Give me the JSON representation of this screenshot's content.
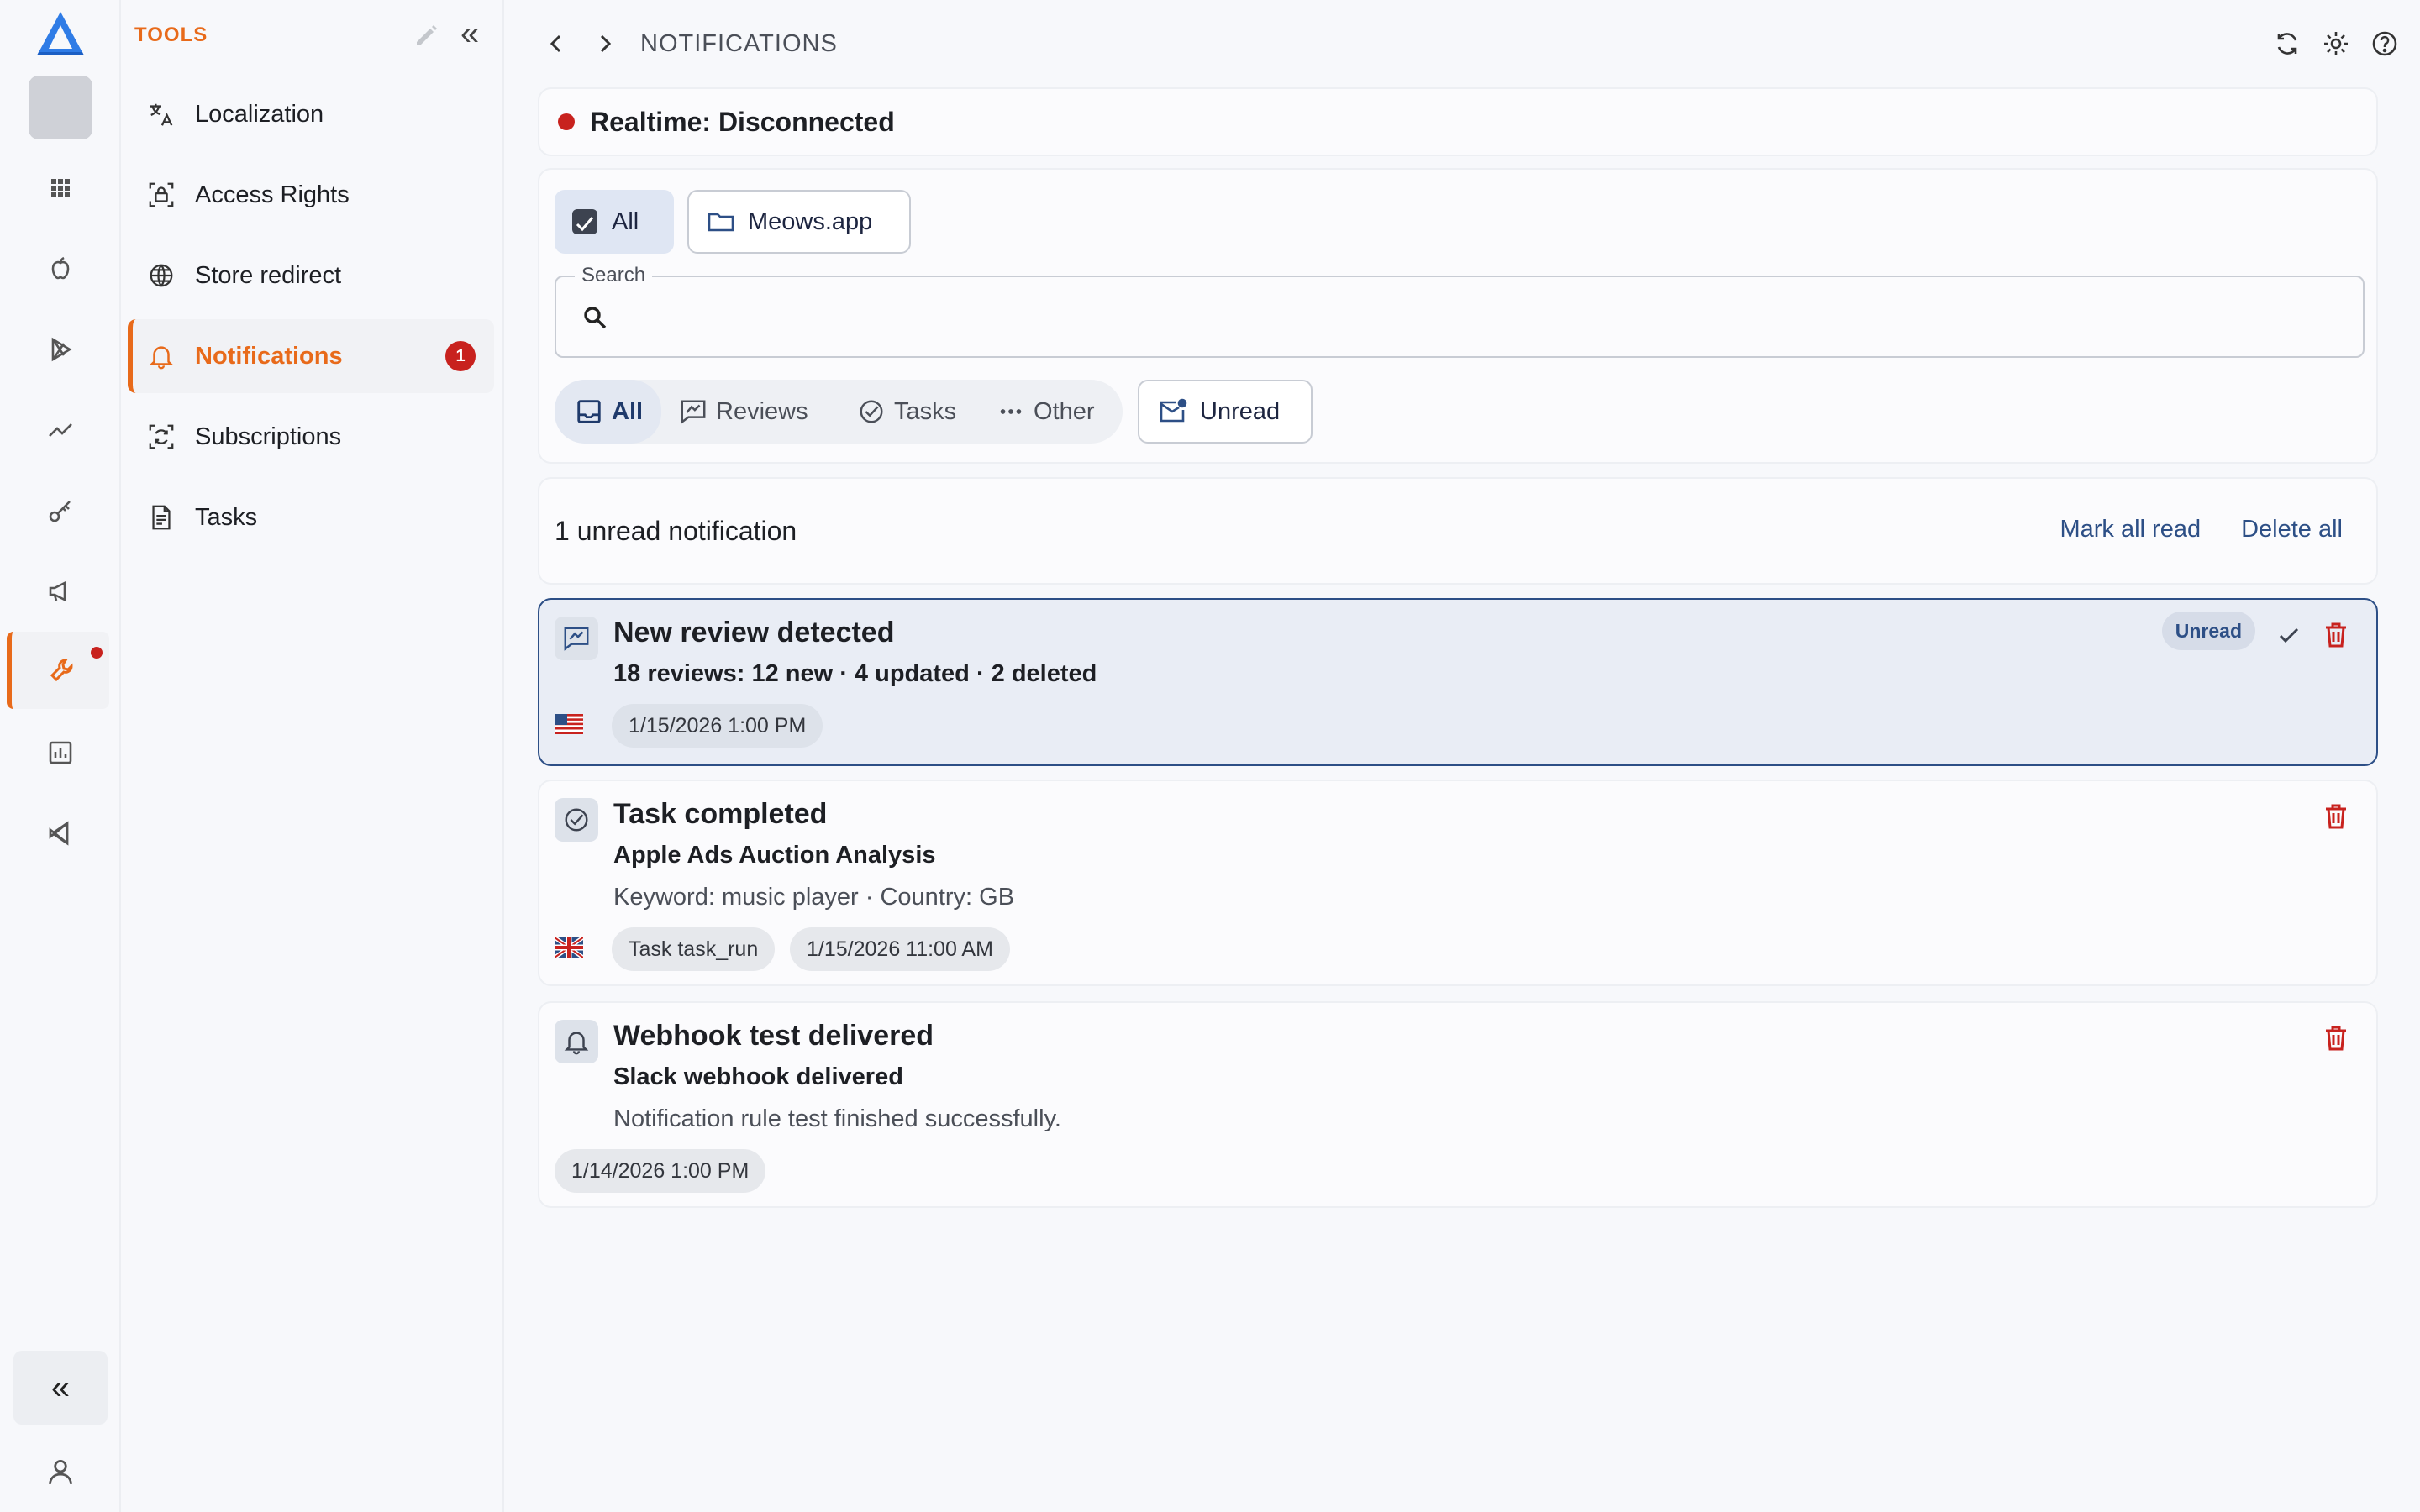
{
  "colors": {
    "accent": "#e86a1a",
    "danger": "#c8221e",
    "link": "#2d4f86"
  },
  "tools_panel": {
    "heading": "TOOLS",
    "items": [
      {
        "label": "Localization",
        "icon": "translate-icon"
      },
      {
        "label": "Access Rights",
        "icon": "access-rights-icon"
      },
      {
        "label": "Store redirect",
        "icon": "globe-icon"
      },
      {
        "label": "Notifications",
        "icon": "bell-icon",
        "badge": "1",
        "active": true
      },
      {
        "label": "Subscriptions",
        "icon": "subscriptions-icon"
      },
      {
        "label": "Tasks",
        "icon": "tasks-icon"
      }
    ]
  },
  "header": {
    "title": "NOTIFICATIONS"
  },
  "realtime": {
    "status": "Realtime: Disconnected"
  },
  "scope": {
    "all": "All",
    "app": "Meows.app"
  },
  "search": {
    "label": "Search",
    "placeholder": "",
    "value": ""
  },
  "type_filter": {
    "all": "All",
    "reviews": "Reviews",
    "tasks": "Tasks",
    "other": "Other"
  },
  "unread_toggle": "Unread",
  "summary": {
    "count_text": "1 unread notification",
    "mark_all": "Mark all read",
    "delete_all": "Delete all"
  },
  "notifications": [
    {
      "title": "New review detected",
      "subtitle": "18 reviews: 12 new · 4 updated · 2 deleted",
      "badge": "Unread",
      "flag": "us-flag",
      "tags": [
        "1/15/2026 1:00 PM"
      ]
    },
    {
      "title": "Task completed",
      "subtitle": "Apple Ads Auction Analysis",
      "description": "Keyword: music player · Country: GB",
      "flag": "gb-flag",
      "tags": [
        "Task task_run",
        "1/15/2026 11:00 AM"
      ]
    },
    {
      "title": "Webhook test delivered",
      "subtitle": "Slack webhook delivered",
      "description": "Notification rule test finished successfully.",
      "tags": [
        "1/14/2026 1:00 PM"
      ]
    }
  ]
}
